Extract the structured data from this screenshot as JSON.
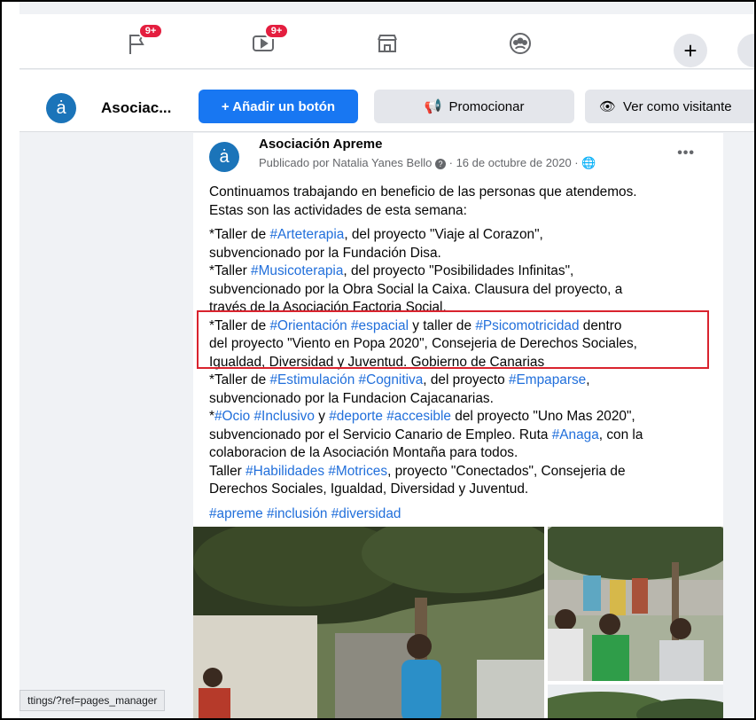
{
  "topnav": {
    "badge_1": "9+",
    "badge_2": "9+",
    "icons": [
      "flag-icon",
      "video-icon",
      "marketplace-icon",
      "groups-icon",
      "plus-icon"
    ]
  },
  "pagebar": {
    "page_name": "Asociac...",
    "add_button_label": "+ Añadir un botón",
    "promote_label": "Promocionar",
    "view_as_label": "Ver como visitante"
  },
  "post": {
    "author": "Asociación Apreme",
    "meta_prefix": "Publicado por Natalia Yanes Bello",
    "meta_date": "· 16 de octubre de 2020 ·",
    "more": "•••",
    "intro_1": "Continuamos trabajando en beneficio de las personas que atendemos.",
    "intro_2": "Estas son las actividades de esta semana:",
    "tags_footer": "#apreme #inclusión #diversidad"
  },
  "status_url": "ttings/?ref=pages_manager",
  "colors": {
    "accent": "#1877f2",
    "hashtag": "#216fdb",
    "highlight": "#d9232e"
  }
}
